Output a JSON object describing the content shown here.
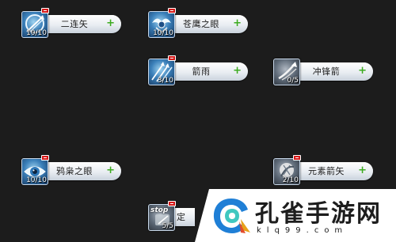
{
  "skills": [
    {
      "name": "二连矢",
      "level": "10/10",
      "plus": "+",
      "icon": "twin-arrow-icon"
    },
    {
      "name": "苍鹰之眼",
      "level": "10/10",
      "plus": "+",
      "icon": "hawk-eye-icon"
    },
    {
      "name": "箭雨",
      "level": "3/10",
      "plus": "+",
      "icon": "arrow-rain-icon"
    },
    {
      "name": "冲锋箭",
      "level": "0/5",
      "plus": "+",
      "icon": "charge-arrow-icon"
    },
    {
      "name": "鸦枭之眼",
      "level": "10/10",
      "plus": "+",
      "icon": "owl-eye-icon"
    },
    {
      "name": "元素箭矢",
      "level": "2/10",
      "plus": "+",
      "icon": "element-arrow-icon"
    },
    {
      "name": "定",
      "level": "5/5",
      "plus": "",
      "icon": "stop-icon",
      "icon_text": "stop"
    }
  ],
  "watermark": {
    "brand": "孔雀手游网",
    "url": "klq99.com"
  },
  "colors": {
    "background": "#1c1c1c",
    "plus": "#3cab1f",
    "minus_badge": "#d61a1a"
  }
}
